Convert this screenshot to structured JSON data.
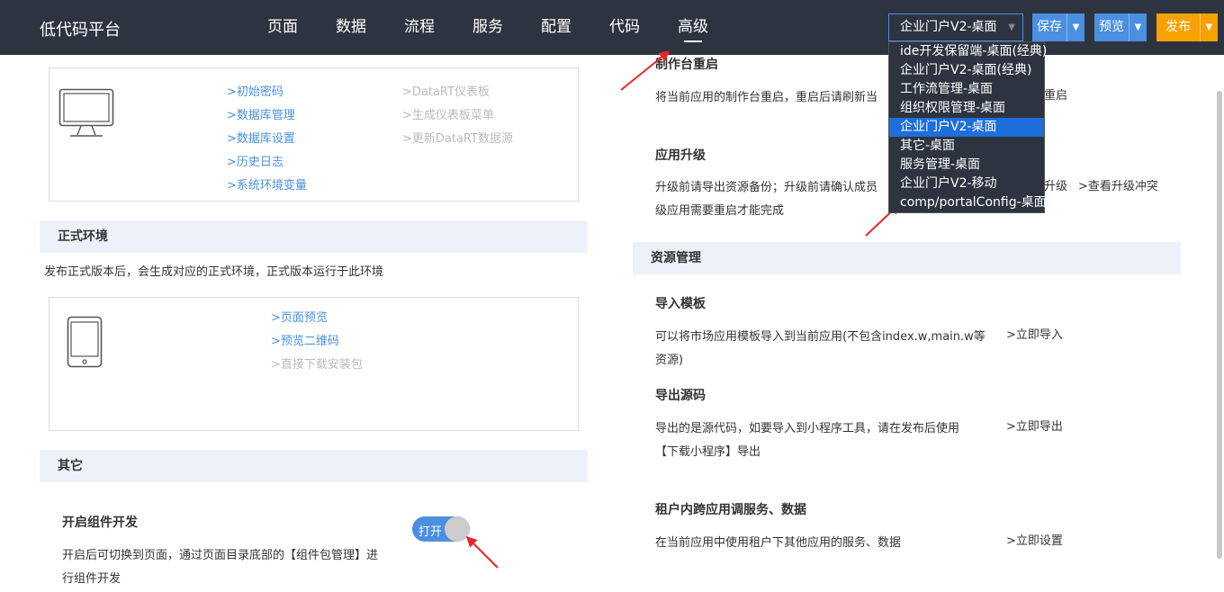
{
  "header": {
    "brand": "低代码平台",
    "nav": [
      "页面",
      "数据",
      "流程",
      "服务",
      "配置",
      "代码",
      "高级"
    ],
    "active_nav": "高级",
    "app_select": "企业门户V2-桌面",
    "save_label": "保存",
    "preview_label": "预览",
    "publish_label": "发布"
  },
  "dropdown": {
    "items": [
      "ide开发保留端-桌面(经典)",
      "企业门户V2-桌面(经典)",
      "工作流管理-桌面",
      "组织权限管理-桌面",
      "企业门户V2-桌面",
      "其它-桌面",
      "服务管理-桌面",
      "企业门户V2-移动",
      "comp/portalConfig-桌面"
    ],
    "selected": "企业门户V2-桌面"
  },
  "left": {
    "desktop_links_col1": [
      ">初始密码",
      ">数据库管理",
      ">数据库设置",
      ">历史日志",
      ">系统环境变量"
    ],
    "desktop_links_col2": [
      ">DataRT仪表板",
      ">生成仪表板菜单",
      ">更新DataRT数据源"
    ],
    "prod_section": "正式环境",
    "prod_desc": "发布正式版本后，会生成对应的正式环境，正式版本运行于此环境",
    "mobile_links": [
      ">页面预览",
      ">预览二维码",
      ">直接下载安装包"
    ],
    "other_section": "其它",
    "component_title": "开启组件开发",
    "component_desc_1": "开启后可切换到页面，通过页面目录底部的【组件包管理】进",
    "component_desc_2": "行组件开发",
    "toggle_label": "打开"
  },
  "right": {
    "restart_title": "制作台重启",
    "restart_desc": "将当前应用的制作台重启，重启后请刷新当",
    "restart_link": "重启",
    "upgrade_title": "应用升级",
    "upgrade_desc_1": "升级前请导出资源备份；升级前请确认成员",
    "upgrade_desc_2": "级应用需要重启才能完成",
    "upgrade_link": "升级",
    "upgrade_conflict_link": ">查看升级冲突",
    "resource_section": "资源管理",
    "import_title": "导入模板",
    "import_desc_1": "可以将市场应用模板导入到当前应用(不包含index.w,main.w等",
    "import_desc_2": "资源)",
    "import_link": ">立即导入",
    "export_title": "导出源码",
    "export_desc_1": "导出的是源代码，如要导入到小程序工具，请在发布后使用",
    "export_desc_2": "【下载小程序】导出",
    "export_link": ">立即导出",
    "tenant_title": "租户内跨应用调服务、数据",
    "tenant_desc": "在当前应用中使用租户下其他应用的服务、数据",
    "tenant_link": ">立即设置"
  },
  "colors": {
    "topbar": "#2d3440",
    "accent": "#4a8fe0",
    "publish": "#f7a100",
    "annotation_arrow": "#e8262a"
  }
}
